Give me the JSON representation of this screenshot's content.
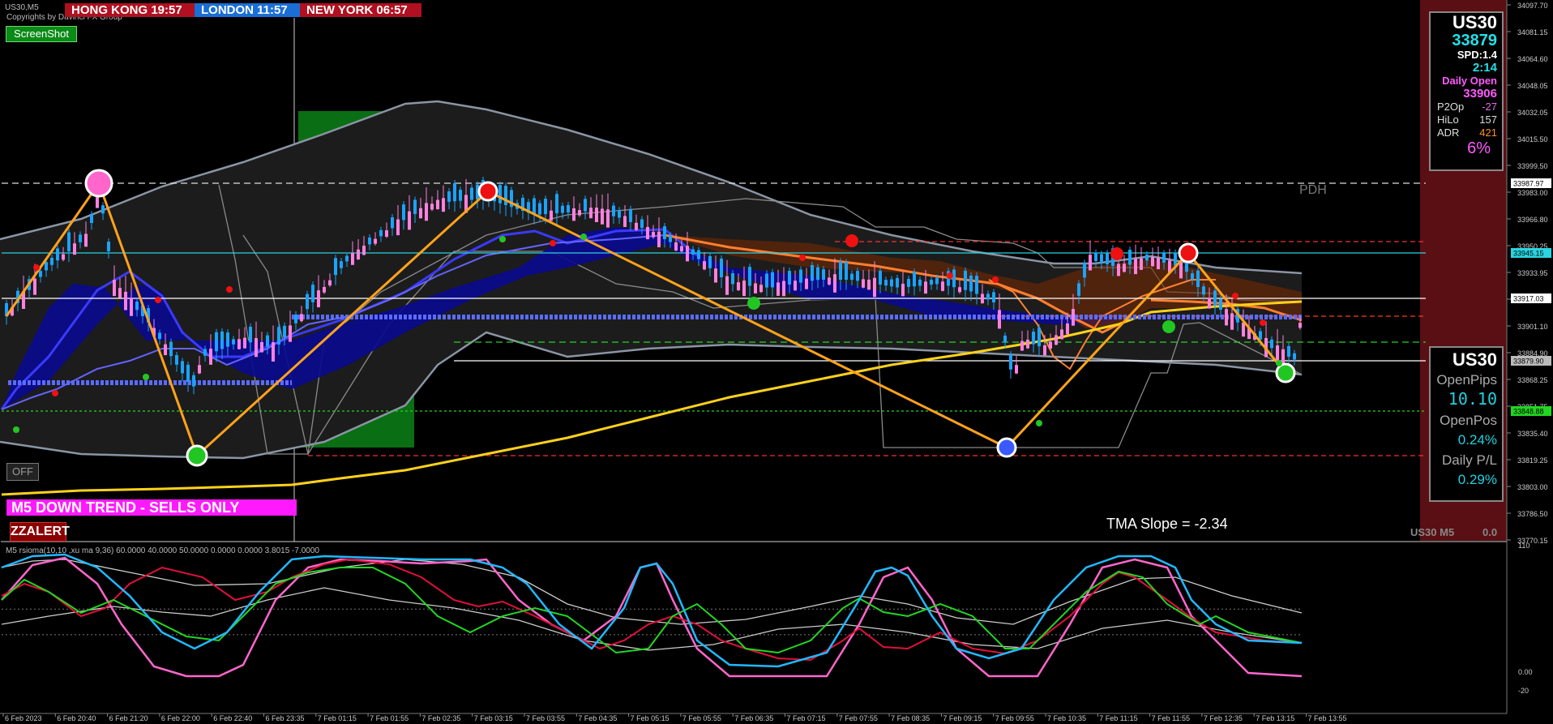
{
  "header": {
    "symbol": "US30,M5",
    "copyright": "Copyrights by Davinci FX Group",
    "sessions": [
      {
        "label": "HONG KONG  19:57",
        "color": "#b01020"
      },
      {
        "label": "LONDON  11:57",
        "color": "#1a6fd6"
      },
      {
        "label": "NEW YORK  06:57",
        "color": "#b01020"
      }
    ]
  },
  "buttons": {
    "screenshot": "ScreenShot",
    "off": "OFF"
  },
  "trend_banner": "M5  DOWN TREND - SELLS ONLY",
  "zzalert": "ZZALERT",
  "pdh_label": "PDH",
  "tma_slope": "TMA Slope = -2.34",
  "bottom_right_label": "US30 M5",
  "bottom_right_value": "0.0",
  "info_panel": {
    "symbol": "US30",
    "price": "33879",
    "spread": "SPD:1.4",
    "timer": "2:14",
    "daily_open_label": "Daily Open",
    "daily_open": "33906",
    "rows": [
      {
        "label": "P2Op",
        "value": "-27",
        "color": "#e070e0"
      },
      {
        "label": "HiLo",
        "value": "157",
        "color": "#dddddd"
      },
      {
        "label": "ADR",
        "value": "421",
        "color": "#ff9020"
      }
    ],
    "percent": "6%"
  },
  "pnl_panel": {
    "symbol": "US30",
    "open_pips_label": "OpenPips",
    "open_pips": "10.10",
    "open_pos_label": "OpenPos",
    "open_pos": "0.24%",
    "daily_pl_label": "Daily P/L",
    "daily_pl": "0.29%"
  },
  "subwindow_title": "M5  rsioma(10,10 ,xu ma 9,36) 60.0000 40.0000 50.0000 0.0000 0.0000 3.8015 -7.0000",
  "colors": {
    "bull": "#1aa3ff",
    "bear": "#ff80e0",
    "tma": "#3a3aff",
    "ma_slow": "#ffd21a",
    "zigzag": "#ffa31a",
    "band": "#8a95a5",
    "green_zone": "#0a6e14",
    "red_zone": "#5a0f14"
  },
  "chart_data": [
    {
      "type": "line",
      "title": "US30,M5",
      "y_axis_ticks": [
        "34097.70",
        "34081.15",
        "34064.60",
        "34048.05",
        "34032.05",
        "34015.50",
        "33999.50",
        "33983.00",
        "33966.80",
        "33950.25",
        "33933.95",
        "33917.03",
        "33901.10",
        "33884.90",
        "33868.25",
        "33851.75",
        "33835.40",
        "33819.25",
        "33803.00",
        "33786.50",
        "33770.15"
      ],
      "ylim": [
        33770.15,
        34097.7
      ],
      "price_tags": [
        {
          "value": "33987.97",
          "color": "#ffffff"
        },
        {
          "value": "33945.15",
          "color": "#2ad4e0"
        },
        {
          "value": "33917.03",
          "color": "#ffffff"
        },
        {
          "value": "33879.90",
          "color": "#bbbbbb"
        },
        {
          "value": "33848.88",
          "color": "#22d622"
        }
      ],
      "x_ticks": [
        "6 Feb 2023",
        "6 Feb 20:40",
        "6 Feb 21:20",
        "6 Feb 22:00",
        "6 Feb 22:40",
        "6 Feb 23:35",
        "7 Feb 01:15",
        "7 Feb 01:55",
        "7 Feb 02:35",
        "7 Feb 03:15",
        "7 Feb 03:55",
        "7 Feb 04:35",
        "7 Feb 05:15",
        "7 Feb 05:55",
        "7 Feb 06:35",
        "7 Feb 07:15",
        "7 Feb 07:55",
        "7 Feb 08:35",
        "7 Feb 09:15",
        "7 Feb 09:55",
        "7 Feb 10:35",
        "7 Feb 11:15",
        "7 Feb 11:55",
        "7 Feb 12:35",
        "7 Feb 13:15",
        "7 Feb 13:55"
      ],
      "series": [
        {
          "name": "zigzag",
          "values": [
            33901,
            33987,
            33823,
            33984,
            33826,
            33945,
            33874
          ]
        },
        {
          "name": "close",
          "values": [
            33905,
            33960,
            33880,
            33840,
            33895,
            33910,
            33955,
            33980,
            33970,
            33960,
            33940,
            33930,
            33925,
            33920,
            33915,
            33905,
            33830,
            33870,
            33910,
            33930,
            33920,
            33895,
            33880
          ]
        }
      ]
    },
    {
      "type": "line",
      "title": "rsioma(10,10 ,xu ma 9,36)",
      "y_axis_ticks": [
        "110",
        "0.00",
        "-20"
      ],
      "ylim": [
        -20,
        110
      ],
      "levels": [
        60,
        40,
        50
      ]
    }
  ]
}
